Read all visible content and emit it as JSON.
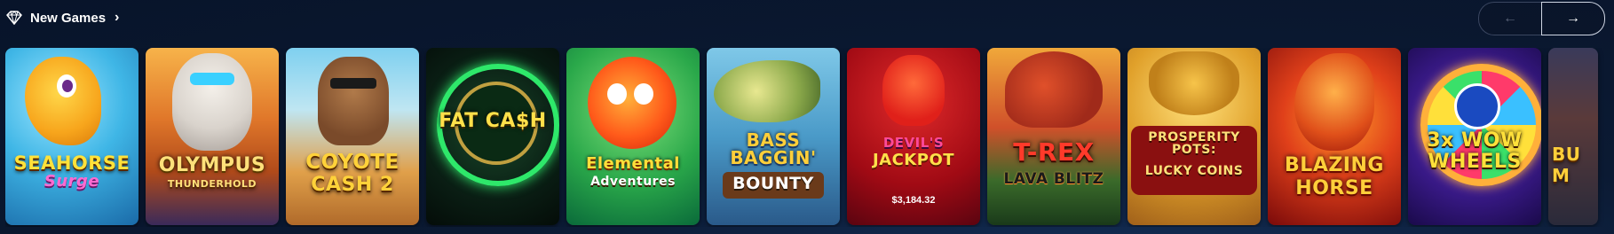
{
  "section": {
    "title": "New Games",
    "icon": "diamond-icon",
    "chevron": "›"
  },
  "nav": {
    "prev_icon": "←",
    "next_icon": "→"
  },
  "games": [
    {
      "line1": "SEAHORSE",
      "line2": "Surge",
      "jackpot": ""
    },
    {
      "line1": "OLYMPUS",
      "line2": "THUNDERHOLD",
      "jackpot": ""
    },
    {
      "line1": "COYOTE",
      "line2": "CASH 2",
      "jackpot": ""
    },
    {
      "line1": "FAT CA$H",
      "line2": "",
      "jackpot": ""
    },
    {
      "line1": "Elemental",
      "line2": "Adventures",
      "jackpot": ""
    },
    {
      "line1": "BASS BAGGIN'",
      "line2": "BOUNTY",
      "jackpot": ""
    },
    {
      "line1": "DEVIL'S",
      "line2": "JACKPOT",
      "jackpot": "$3,184.32"
    },
    {
      "line1": "T-REX",
      "line2": "LAVA BLITZ",
      "jackpot": ""
    },
    {
      "line1": "PROSPERITY POTS:",
      "line2": "LUCKY COINS",
      "jackpot": ""
    },
    {
      "line1": "BLAZING",
      "line2": "HORSE",
      "jackpot": ""
    },
    {
      "line1": "3x WOW",
      "line2": "WHEELS",
      "jackpot": ""
    },
    {
      "line1": "BU",
      "line2": "M",
      "jackpot": ""
    }
  ]
}
